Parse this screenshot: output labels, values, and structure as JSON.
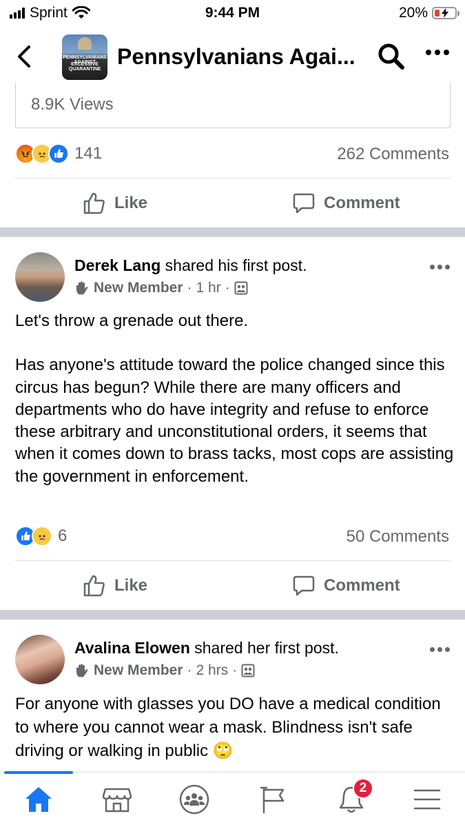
{
  "status_bar": {
    "carrier": "Sprint",
    "time": "9:44 PM",
    "battery": "20%",
    "battery_level": 0.2
  },
  "header": {
    "group_name": "Pennsylvanians Agai...",
    "thumbnail_line1": "PENNSYLVANIANS AGAINST",
    "thumbnail_line2": "EXCESSIVE QUARANTINE"
  },
  "prev_post": {
    "views": "8.9K Views",
    "reaction_count": "141",
    "reactions": [
      "angry",
      "sad",
      "like"
    ],
    "comments": "262 Comments",
    "like_label": "Like",
    "comment_label": "Comment"
  },
  "posts": [
    {
      "author": "Derek Lang",
      "action": " shared his first post.",
      "badge": "New Member",
      "time": "1 hr",
      "paragraphs": [
        "Let's throw a grenade out there.",
        "Has anyone's attitude toward the police changed since this circus has begun? While there are many officers and departments who do have integrity and refuse to enforce these arbitrary and unconstitutional orders, it seems that when it comes down to brass tacks, most cops are assisting the government in enforcement."
      ],
      "reaction_count": "6",
      "reactions": [
        "like",
        "sad"
      ],
      "comments": "50 Comments",
      "like_label": "Like",
      "comment_label": "Comment"
    },
    {
      "author": "Avalina Elowen",
      "action": " shared her first post.",
      "badge": "New Member",
      "time": "2 hrs",
      "paragraphs": [
        "For anyone with glasses you DO have a medical condition to where you cannot wear a mask. Blindness isn't safe driving or walking in public 🙄"
      ]
    }
  ],
  "bottom_nav": {
    "items": [
      "home-icon",
      "marketplace-icon",
      "groups-icon",
      "pages-flag-icon",
      "notifications-bell-icon",
      "menu-icon"
    ],
    "notification_badge": "2"
  },
  "colors": {
    "accent": "#1877f2",
    "secondary_text": "#65676b",
    "badge": "#e41e3f"
  }
}
